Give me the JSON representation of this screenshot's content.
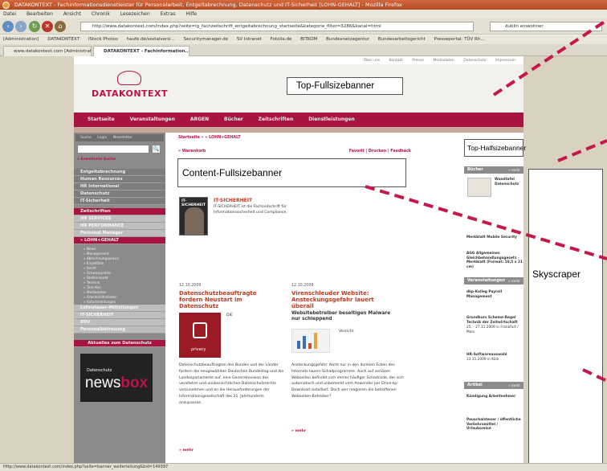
{
  "browser": {
    "title": "DATAKONTEXT - Fachinformationsdienstleister für Personalarbeit, Entgeltabrechnung, Datenschutz und IT-Sicherheit [LOHN-GEHALT] - Mozilla Firefox",
    "menu": [
      "Datei",
      "Bearbeiten",
      "Ansicht",
      "Chronik",
      "Lesezeichen",
      "Extras",
      "Hilfe"
    ],
    "url": "http://www.datakontext.com/index.php?seite=lg_fachzeitschrift_entgeltabrechnung_startseite&kategorie_filter=3286&kanal=html",
    "search_value": "dublin einwohner",
    "bookmarks": [
      "[Administration]",
      "DATAKONTEXT",
      "iStock Photos",
      "haufe.de/sozialversi...",
      "Securitymanager.de",
      "SV Intranet",
      "Fotolia.de",
      "BITKOM",
      "Bundesnetzagentur",
      "Bundesarbeitsgericht",
      "Presseportal: TÜV Rh..."
    ],
    "tabs": [
      "www.datakontext.com [Administration]",
      "DATAKONTEXT - Fachinformation..."
    ],
    "status": "Http://www.datakontext.com/index.php?seite=banner_weiterleitung&bid=149397"
  },
  "site": {
    "toplinks": [
      "Über uns",
      "Kontakt",
      "Presse",
      "Mediadaten",
      "Datenschutz",
      "Impressum"
    ],
    "logo": "DATAKONTEXT",
    "nav": [
      "Startseite",
      "Veranstaltungen",
      "ARGEN",
      "Bücher",
      "Zeitschriften",
      "Dienstleistungen"
    ],
    "login_tabs": [
      "Suche",
      "Login",
      "Newsletter"
    ],
    "search_go": "🔍",
    "advanced_search": "» Erweiterte Suche",
    "sidebar_top": [
      "Entgeltabrechnung",
      "Human Resources",
      "HR International",
      "Datenschutz",
      "IT-Sicherheit"
    ],
    "sidebar_mid": [
      "Zeitschriften",
      "HR SERVICES",
      "HR PERFORMANCE",
      "Personal.Manager",
      "» LOHN+GEHALT"
    ],
    "sidebar_sub": [
      "» News",
      "» Management",
      "» Abrechnungspraxis",
      "» Einzelfälle",
      "» Recht",
      "» Schwerpunkte",
      "» Stellenmarkt",
      "» Termine",
      "» Test-Abo",
      "» Mediadaten",
      "» Arbeitshilfenlisten",
      "» Sofortmeldungen"
    ],
    "sidebar_bottom": [
      "Lohnsteuer-Mitteilungen",
      "IT-SICHERHEIT",
      "RDV",
      "Personalbetreuung",
      "Aktuelles zum Datenschutz"
    ],
    "newsbox_small": "Datenschutz",
    "newsbox_big1": "news",
    "newsbox_big2": "box"
  },
  "content": {
    "breadcrumb": "Startseite » » LOHN+GEHALT",
    "warenkorb": "» Warenkorb",
    "tools": "Favorit | Drucken | Feedback",
    "mag_title": "IT-SICHERHEIT",
    "mag_text": "IT-SICHERHEIT ist die Fachzeitschrift für Informationssicherheit und Compliance.",
    "mag_cover": "IT-SICHERHEIT",
    "t1_date": "12.10.2009",
    "t1_head": "Datenschutzbeauftragte fordern Neustart im Datenschutz",
    "t1_label": "DIE",
    "t1_lock": "privacy",
    "t1_body": "Datenschutzbeauftragten des Bundes und der Länder fordern die neugewählten Deutschen Bundestag und die Landesparlamente auf, eine Generalrevision des veralteten und unübersichtlichen Datenschutzrechts vorzunehmen und an die Herausforderungen der Informationsgesellschaft des 21. Jahrhunderts anzupassen.",
    "t1_more": "» mehr",
    "t2_date": "12.10.2009",
    "t2_head": "Virenschleuder Website: Ansteckungsgefahr lauert überall",
    "t2_sub": "Websitebetreiber beseitigen Malware nur schleppend",
    "t2_label": "Vorsicht",
    "t2_body": "Ansteckungsgefahr: Nicht nur in den dunklen Ecken des Internets lauern Schadprogramme. Auch auf seriösen Webseiten befindet sich immer häufiger Schadcode, der sich automatisch und unbemerkt vom Anwender per Drive-by-Download installiert. Doch wer reagieren die betroffenen Webseiten-Betreiber?",
    "t2_more": "» mehr"
  },
  "right": {
    "buecher": "Bücher",
    "mehr": "» mehr",
    "book1": "Wandtafel Datenschutz",
    "book2": "Merkblatt Mobile Security",
    "book3": "AGG Allgemeines Gleichbehandlungsgesetz - Merkblatt (Format: 10,5 x 21 cm)",
    "veranstaltungen": "Veranstaltungen",
    "ev1": "dkp-Kolleg Payroll Management",
    "ev2": "Grundkurs Scheme-Regel Technik der Zeitwirtschaft",
    "ev2b": "25. - 27.11.2009 in Frankfurt / Main",
    "ev3": "HR-Softwareauswahl",
    "ev3b": "13.11.2009 in Köln",
    "artikel": "Artikel",
    "ar1": "Kündigung Arbeitnehmer",
    "ar2": "Pauschalsteuer / öffentliche Verkehrsmittel / Urlaubsreise"
  },
  "ads": {
    "top_full": "Top-Fullsizebanner",
    "top_half": "Top-Halfsizebanner",
    "content_full": "Content-Fullsizebanner",
    "skyscraper": "Skyscraper"
  },
  "colors": {
    "brand": "#b8134a",
    "arrow": "#c4184a"
  }
}
